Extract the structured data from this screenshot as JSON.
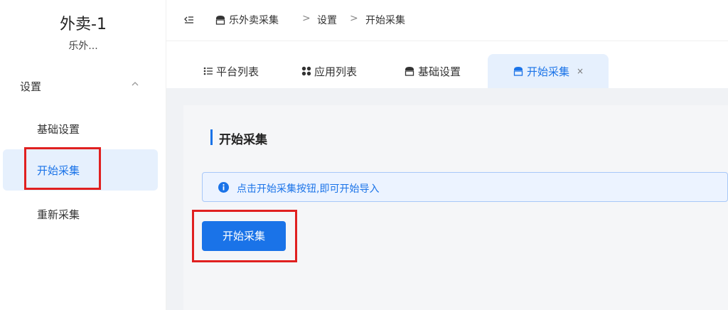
{
  "app": {
    "title": "外卖-1",
    "subtitle": "乐外..."
  },
  "sidebar": {
    "group_label": "设置",
    "items": [
      {
        "label": "基础设置"
      },
      {
        "label": "开始采集"
      },
      {
        "label": "重新采集"
      }
    ]
  },
  "breadcrumb": {
    "items": [
      "乐外卖采集",
      "设置",
      "开始采集"
    ],
    "separator": ">"
  },
  "tabs": [
    {
      "label": "平台列表",
      "icon": "list-icon"
    },
    {
      "label": "应用列表",
      "icon": "apps-icon"
    },
    {
      "label": "基础设置",
      "icon": "store-icon"
    },
    {
      "label": "开始采集",
      "icon": "store-icon",
      "close": "×"
    }
  ],
  "main": {
    "title": "开始采集",
    "alert_text": "点击开始采集按钮,即可开始导入",
    "start_button": "开始采集"
  },
  "colors": {
    "accent": "#1a73e8",
    "highlight_box": "#e02020"
  }
}
